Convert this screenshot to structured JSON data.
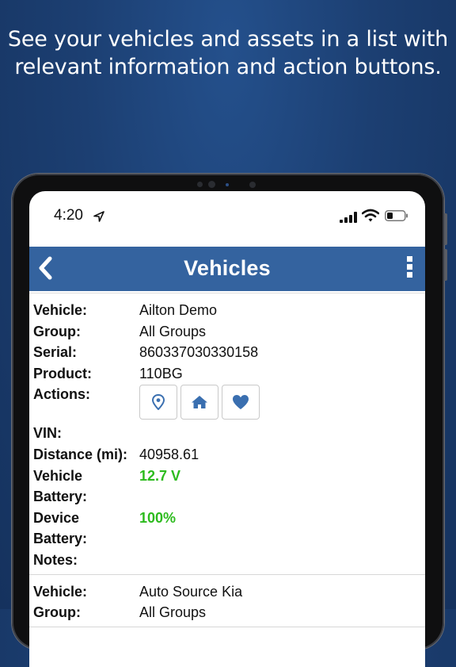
{
  "promo": {
    "line1": "See your vehicles and assets in a list with",
    "line2": "relevant information and action buttons."
  },
  "status_bar": {
    "time": "4:20"
  },
  "navbar": {
    "title": "Vehicles"
  },
  "colors": {
    "accent": "#34639f",
    "good": "#2dbb1e",
    "background": "#1c3f72"
  },
  "icons": [
    "location-pin-icon",
    "home-icon",
    "heart-icon",
    "back-chevron-icon",
    "kebab-menu-icon"
  ],
  "labels": {
    "vehicle": "Vehicle:",
    "group": "Group:",
    "serial": "Serial:",
    "product": "Product:",
    "actions": "Actions:",
    "vin": "VIN:",
    "distance": "Distance (mi):",
    "vehicle_battery_1": "Vehicle",
    "vehicle_battery_2": "Battery:",
    "device_battery_1": "Device",
    "device_battery_2": "Battery:",
    "notes": "Notes:"
  },
  "vehicles": [
    {
      "vehicle": "Ailton Demo",
      "group": "All Groups",
      "serial": "860337030330158",
      "product": "110BG",
      "vin": "",
      "distance": "40958.61",
      "vehicle_battery": "12.7 V",
      "device_battery": "100%",
      "notes": ""
    },
    {
      "vehicle": "Auto Source Kia",
      "group": "All Groups"
    }
  ]
}
